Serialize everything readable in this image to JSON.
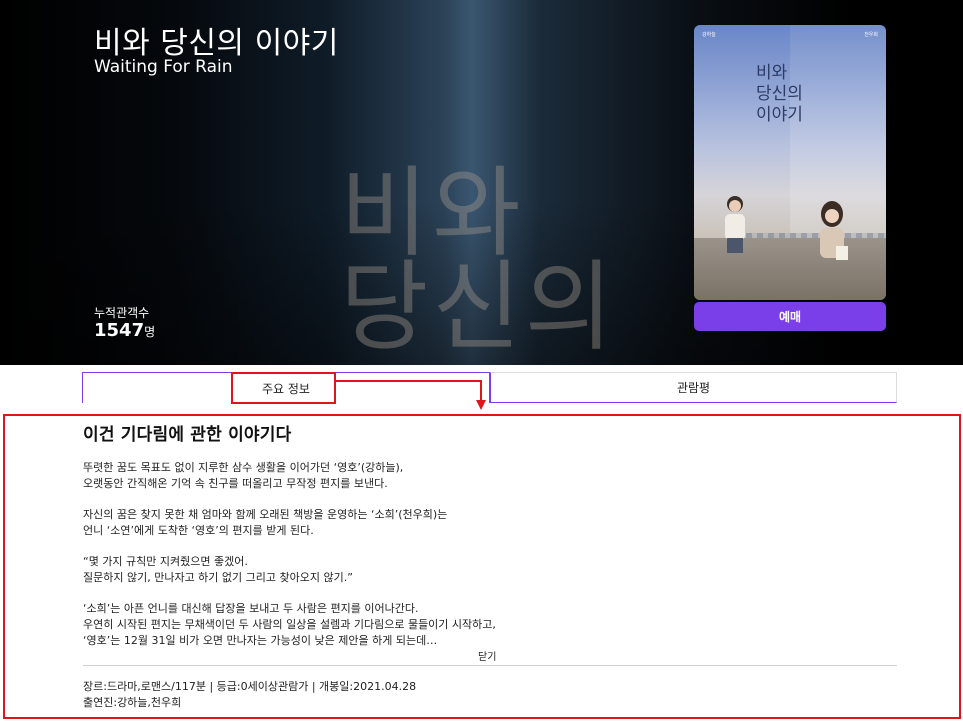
{
  "hero": {
    "title_ko": "비와 당신의 이야기",
    "title_en": "Waiting For Rain",
    "background_lettering": [
      "비와",
      "당신의"
    ],
    "audience_label": "누적관객수",
    "audience_count": "1547",
    "audience_unit": "명",
    "poster": {
      "cast_left": "강하늘",
      "cast_right": "천우희",
      "title_lines": [
        "비와",
        "당신의",
        "이야기"
      ]
    },
    "book_button_label": "예매"
  },
  "tabs": {
    "main_info": "주요 정보",
    "reviews": "관람평"
  },
  "synopsis": {
    "headline": "이건 기다림에 관한 이야기다",
    "paragraphs": [
      [
        "뚜렷한 꿈도 목표도 없이 지루한 삼수 생활을 이어가던 ‘영호’(강하늘),",
        "오랫동안 간직해온 기억 속 친구를 떠올리고 무작정 편지를 보낸다."
      ],
      [
        "자신의 꿈은 찾지 못한 채 엄마와 함께 오래된 책방을 운영하는 ‘소희’(천우희)는",
        "언니 ‘소연’에게 도착한 ‘영호’의 편지를 받게 된다."
      ],
      [
        "“몇 가지 규칙만 지켜줬으면 좋겠어.",
        "질문하지 않기, 만나자고 하기 없기 그리고 찾아오지 않기.”"
      ],
      [
        "‘소희’는 아픈 언니를 대신해 답장을 보내고 두 사람은 편지를 이어나간다.",
        "우연히 시작된 편지는 무채색이던 두 사람의 일상을 설렘과 기다림으로 물들이기 시작하고,",
        "‘영호’는 12월 31일 비가 오면 만나자는 가능성이 낮은 제안을 하게 되는데…"
      ]
    ],
    "close_label": "닫기"
  },
  "meta": {
    "line1": "장르:드라마,로맨스/117분 | 등급:0세이상관람가 | 개봉일:2021.04.28",
    "line2": "출연진:강하늘,천우희"
  },
  "colors": {
    "accent": "#7b3fe9",
    "annotation": "#e0141b"
  }
}
